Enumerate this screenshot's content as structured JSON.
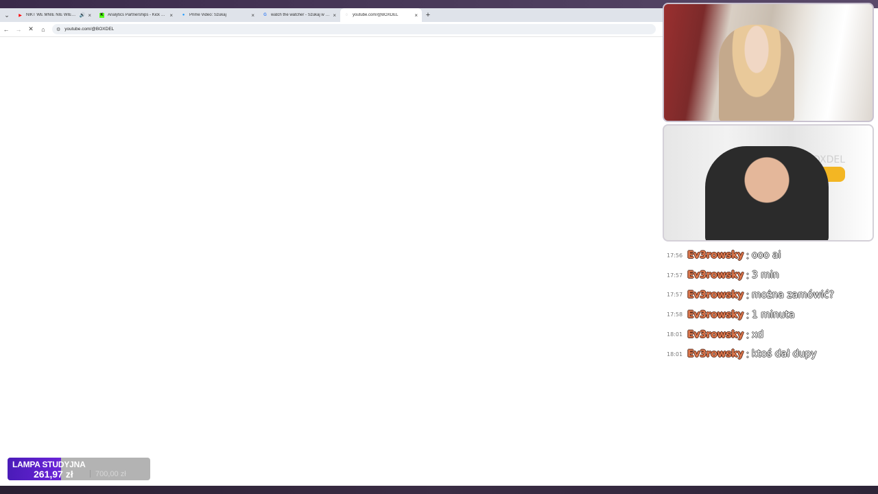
{
  "browser": {
    "tabs": [
      {
        "title": "NIKT WE MNIE NIE WIERZY",
        "favicon": "youtube-icon",
        "color": "#ff0000",
        "audio": true,
        "active": false
      },
      {
        "title": "Analytics Partnerships - Kick Dash",
        "favicon": "kick-icon",
        "color": "#53fc18",
        "audio": false,
        "active": false
      },
      {
        "title": "Prime Video: Szukaj",
        "favicon": "prime-video-icon",
        "color": "#1a98ff",
        "audio": false,
        "active": false
      },
      {
        "title": "watch the watcher - Szukaj w Google",
        "favicon": "google-icon",
        "color": "#4285f4",
        "audio": false,
        "active": false
      },
      {
        "title": "youtube.com/@BOXDEL",
        "favicon": "loading-icon",
        "color": "#888888",
        "audio": false,
        "active": true
      }
    ],
    "url": "youtube.com/@BOXDEL"
  },
  "chat": {
    "messages": [
      {
        "time": "17:56",
        "user": "Ev3rowsky",
        "text": "ooo ai"
      },
      {
        "time": "17:57",
        "user": "Ev3rowsky",
        "text": "3 min"
      },
      {
        "time": "17:57",
        "user": "Ev3rowsky",
        "text": "można zamówić?"
      },
      {
        "time": "17:58",
        "user": "Ev3rowsky",
        "text": "1 minuta"
      },
      {
        "time": "18:01",
        "user": "Ev3rowsky",
        "text": "xd"
      },
      {
        "time": "18:01",
        "user": "Ev3rowsky",
        "text": "ktoś dał dupy"
      }
    ]
  },
  "goal": {
    "name": "LAMPA STUDYJNA",
    "current": "261,97 zł",
    "target": "700,00 zł",
    "progress": 0.374
  },
  "cams": {
    "cam2_logo": "BOXDEL"
  }
}
